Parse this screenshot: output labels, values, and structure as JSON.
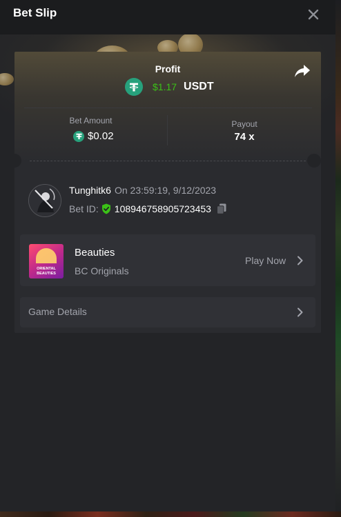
{
  "modal": {
    "title": "Bet Slip"
  },
  "profit": {
    "label": "Profit",
    "value": "$1.17",
    "currency": "USDT"
  },
  "bet": {
    "amount_label": "Bet Amount",
    "amount_value": "$0.02",
    "payout_label": "Payout",
    "payout_value": "74 x"
  },
  "user": {
    "name": "Tunghitk6",
    "timestamp": "On 23:59:19, 9/12/2023",
    "bet_id_label": "Bet ID:",
    "bet_id": "108946758905723453"
  },
  "game": {
    "name": "Beauties",
    "provider": "BC Originals",
    "play_label": "Play Now",
    "thumb_text": [
      "ORIENTAL",
      "BEAUTIES"
    ]
  },
  "details": {
    "label": "Game Details"
  },
  "icons": {
    "currency": "tether-icon",
    "share": "share-icon",
    "close": "close-icon",
    "verified": "shield-check-icon",
    "copy": "copy-icon",
    "chevron": "chevron-right-icon"
  },
  "colors": {
    "profit_green": "#3bc117",
    "tether": "#27a17c",
    "muted_text": "#a3a5ad"
  }
}
